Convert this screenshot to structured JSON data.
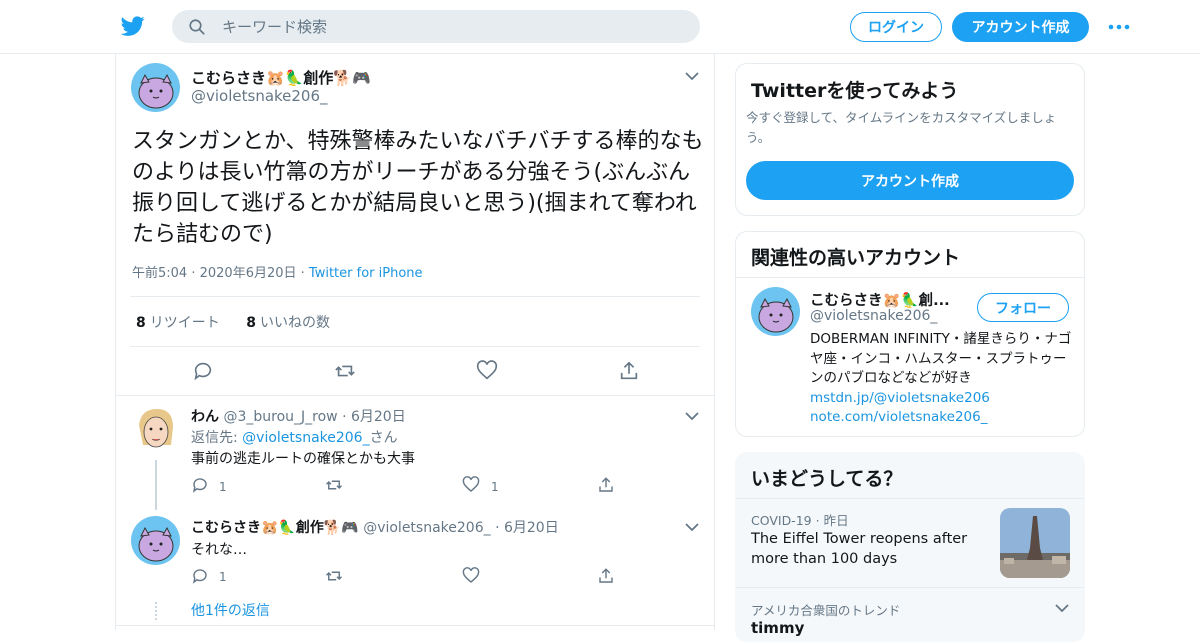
{
  "header": {
    "search_placeholder": "キーワード検索",
    "login_label": "ログイン",
    "signup_label": "アカウント作成"
  },
  "tweet": {
    "author_name": "こむらさき🐹🦜創作🐕🎮",
    "author_handle": "@violetsnake206_",
    "text": "スタンガンとか、特殊警棒みたいなバチバチする棒的なものよりは長い竹箒の方がリーチがある分強そう(ぶんぶん振り回して逃げるとかが結局良いと思う)(掴まれて奪われたら詰むので)",
    "time": "午前5:04",
    "date": "2020年6月20日",
    "source": "Twitter for iPhone",
    "retweets_count": "8",
    "retweets_label": "リツイート",
    "likes_count": "8",
    "likes_label": "いいねの数"
  },
  "replies": [
    {
      "name": "わん",
      "handle": "@3_burou_J_row",
      "date": "6月20日",
      "reply_to_label": "返信先: ",
      "reply_to_handle": "@violetsnake206_",
      "reply_to_suffix": "さん",
      "text": "事前の逃走ルートの確保とかも大事",
      "reply_count": "1",
      "like_count": "1"
    },
    {
      "name": "こむらさき🐹🦜創作🐕🎮",
      "handle": "@violetsnake206_",
      "date": "6月20日",
      "text": "それな…",
      "reply_count": "1"
    }
  ],
  "more_replies_label": "他1件の返信",
  "sidebar": {
    "try_title": "Twitterを使ってみよう",
    "try_text": "今すぐ登録して、タイムラインをカスタマイズしましょう。",
    "try_button": "アカウント作成",
    "related_title": "関連性の高いアカウント",
    "related_name": "こむらさき🐹🦜創...",
    "related_handle": "@violetsnake206_",
    "follow_label": "フォロー",
    "related_bio": "DOBERMAN INFINITY・諸星きらり・ナゴヤ座・インコ・ハムスター・スプラトゥーンのパブロなどなどが好き",
    "related_link1": "mstdn.jp/@violetsnake206",
    "related_link2": "note.com/violetsnake206_",
    "trends_title": "いまどうしてる？",
    "trend1_category": "COVID-19",
    "trend1_time": "昨日",
    "trend1_text": "The Eiffel Tower reopens after more than 100 days",
    "trend2_category": "アメリカ合衆国のトレンド",
    "trend2_text": "timmy"
  },
  "colors": {
    "accent": "#1da1f2",
    "border": "#e6ecf0",
    "muted": "#657786",
    "text": "#14171a"
  }
}
